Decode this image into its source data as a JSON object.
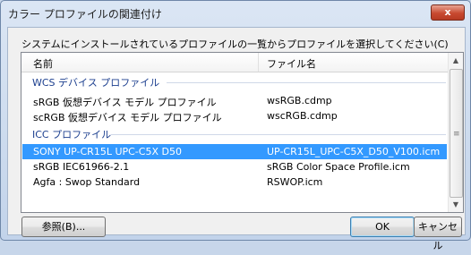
{
  "window": {
    "title": "カラー プロファイルの関連付け",
    "close_label": "x"
  },
  "instruction": "システムにインストールされているプロファイルの一覧からプロファイルを選択してください(C)",
  "list": {
    "columns": {
      "name": "名前",
      "file": "ファイル名"
    },
    "groups": [
      {
        "label": "WCS デバイス プロファイル"
      },
      {
        "label": "ICC プロファイル"
      }
    ],
    "wcs_rows": [
      {
        "name": "sRGB 仮想デバイス モデル プロファイル",
        "file": "wsRGB.cdmp"
      },
      {
        "name": "scRGB 仮想デバイス モデル プロファイル",
        "file": "wscRGB.cdmp"
      }
    ],
    "icc_rows": [
      {
        "name": "SONY UP-CR15L UPC-C5X D50",
        "file": "UP-CR15L_UPC-C5X_D50_V100.icm",
        "selected": true
      },
      {
        "name": "sRGB IEC61966-2.1",
        "file": "sRGB Color Space Profile.icm"
      },
      {
        "name": "Agfa : Swop Standard",
        "file": "RSWOP.icm"
      }
    ]
  },
  "buttons": {
    "browse": "参照(B)...",
    "ok": "OK",
    "cancel": "キャンセル"
  }
}
